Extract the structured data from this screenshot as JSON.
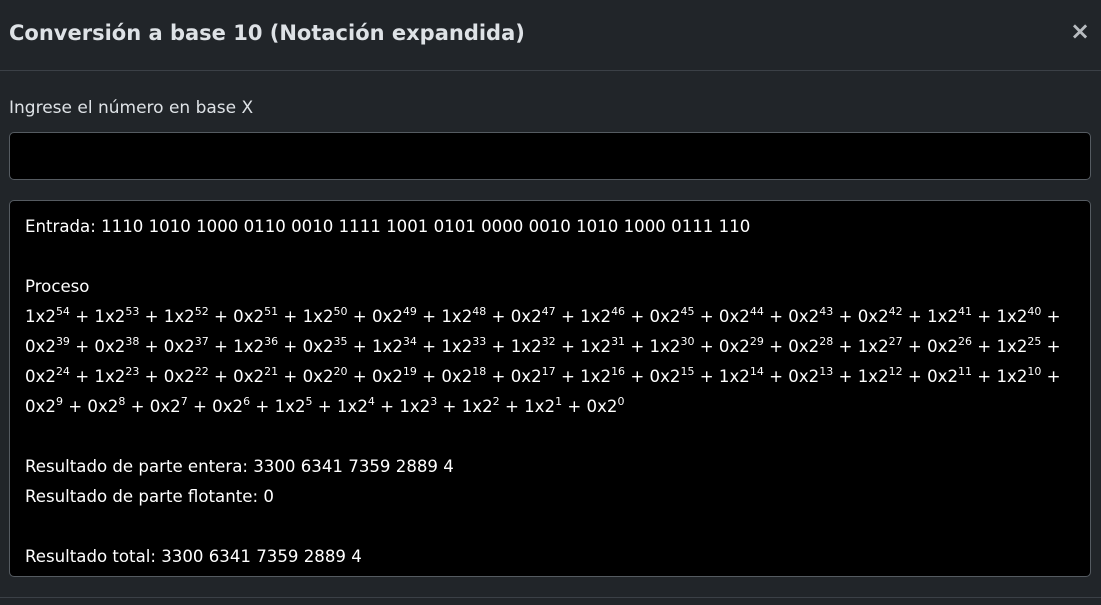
{
  "modal": {
    "title": "Conversión a base 10 (Notación expandida)",
    "close_label": "×"
  },
  "form": {
    "label": "Ingrese el número en base X",
    "input_value": "",
    "input_placeholder": ""
  },
  "output": {
    "entrada_label": "Entrada:",
    "entrada_value": "1110 1010 1000 0110 0010 1111 1001 0101 0000 0010 1010 1000 0111 110",
    "proceso_label": "Proceso",
    "terms": [
      {
        "coef": "1",
        "base": "2",
        "exp": "54"
      },
      {
        "coef": "1",
        "base": "2",
        "exp": "53"
      },
      {
        "coef": "1",
        "base": "2",
        "exp": "52"
      },
      {
        "coef": "0",
        "base": "2",
        "exp": "51"
      },
      {
        "coef": "1",
        "base": "2",
        "exp": "50"
      },
      {
        "coef": "0",
        "base": "2",
        "exp": "49"
      },
      {
        "coef": "1",
        "base": "2",
        "exp": "48"
      },
      {
        "coef": "0",
        "base": "2",
        "exp": "47"
      },
      {
        "coef": "1",
        "base": "2",
        "exp": "46"
      },
      {
        "coef": "0",
        "base": "2",
        "exp": "45"
      },
      {
        "coef": "0",
        "base": "2",
        "exp": "44"
      },
      {
        "coef": "0",
        "base": "2",
        "exp": "43"
      },
      {
        "coef": "0",
        "base": "2",
        "exp": "42"
      },
      {
        "coef": "1",
        "base": "2",
        "exp": "41"
      },
      {
        "coef": "1",
        "base": "2",
        "exp": "40"
      },
      {
        "coef": "0",
        "base": "2",
        "exp": "39"
      },
      {
        "coef": "0",
        "base": "2",
        "exp": "38"
      },
      {
        "coef": "0",
        "base": "2",
        "exp": "37"
      },
      {
        "coef": "1",
        "base": "2",
        "exp": "36"
      },
      {
        "coef": "0",
        "base": "2",
        "exp": "35"
      },
      {
        "coef": "1",
        "base": "2",
        "exp": "34"
      },
      {
        "coef": "1",
        "base": "2",
        "exp": "33"
      },
      {
        "coef": "1",
        "base": "2",
        "exp": "32"
      },
      {
        "coef": "1",
        "base": "2",
        "exp": "31"
      },
      {
        "coef": "1",
        "base": "2",
        "exp": "30"
      },
      {
        "coef": "0",
        "base": "2",
        "exp": "29"
      },
      {
        "coef": "0",
        "base": "2",
        "exp": "28"
      },
      {
        "coef": "1",
        "base": "2",
        "exp": "27"
      },
      {
        "coef": "0",
        "base": "2",
        "exp": "26"
      },
      {
        "coef": "1",
        "base": "2",
        "exp": "25"
      },
      {
        "coef": "0",
        "base": "2",
        "exp": "24"
      },
      {
        "coef": "1",
        "base": "2",
        "exp": "23"
      },
      {
        "coef": "0",
        "base": "2",
        "exp": "22"
      },
      {
        "coef": "0",
        "base": "2",
        "exp": "21"
      },
      {
        "coef": "0",
        "base": "2",
        "exp": "20"
      },
      {
        "coef": "0",
        "base": "2",
        "exp": "19"
      },
      {
        "coef": "0",
        "base": "2",
        "exp": "18"
      },
      {
        "coef": "0",
        "base": "2",
        "exp": "17"
      },
      {
        "coef": "1",
        "base": "2",
        "exp": "16"
      },
      {
        "coef": "0",
        "base": "2",
        "exp": "15"
      },
      {
        "coef": "1",
        "base": "2",
        "exp": "14"
      },
      {
        "coef": "0",
        "base": "2",
        "exp": "13"
      },
      {
        "coef": "1",
        "base": "2",
        "exp": "12"
      },
      {
        "coef": "0",
        "base": "2",
        "exp": "11"
      },
      {
        "coef": "1",
        "base": "2",
        "exp": "10"
      },
      {
        "coef": "0",
        "base": "2",
        "exp": "9"
      },
      {
        "coef": "0",
        "base": "2",
        "exp": "8"
      },
      {
        "coef": "0",
        "base": "2",
        "exp": "7"
      },
      {
        "coef": "0",
        "base": "2",
        "exp": "6"
      },
      {
        "coef": "1",
        "base": "2",
        "exp": "5"
      },
      {
        "coef": "1",
        "base": "2",
        "exp": "4"
      },
      {
        "coef": "1",
        "base": "2",
        "exp": "3"
      },
      {
        "coef": "1",
        "base": "2",
        "exp": "2"
      },
      {
        "coef": "1",
        "base": "2",
        "exp": "1"
      },
      {
        "coef": "0",
        "base": "2",
        "exp": "0"
      }
    ],
    "term_separator": "+",
    "term_multiplier": "x",
    "resultado_entera_label": "Resultado de parte entera:",
    "resultado_entera_value": "3300 6341 7359 2889 4",
    "resultado_flotante_label": "Resultado de parte flotante:",
    "resultado_flotante_value": "0",
    "resultado_total_label": "Resultado total:",
    "resultado_total_value": "3300 6341 7359 2889 4"
  },
  "colors": {
    "background": "#212529",
    "panel": "#000000",
    "border": "#555b61",
    "text": "#dee2e6"
  }
}
